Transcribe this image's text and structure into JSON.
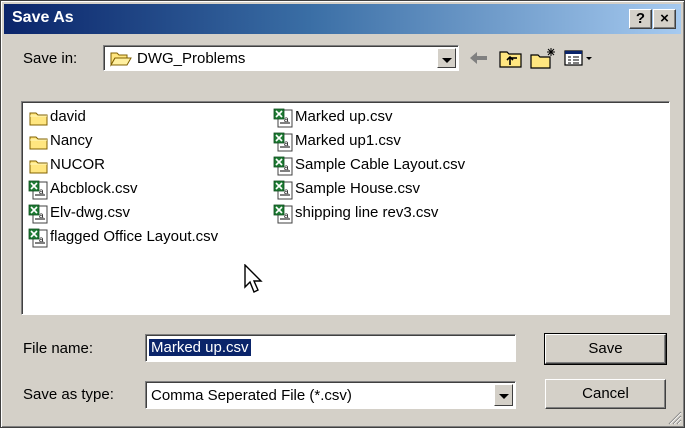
{
  "window": {
    "title": "Save As",
    "help_label": "?",
    "close_label": "×"
  },
  "save_in": {
    "label": "Save in:",
    "value": "DWG_Problems"
  },
  "toolbar": {
    "icons": [
      "back-arrow-icon",
      "up-one-level-icon",
      "new-folder-icon",
      "view-menu-icon"
    ]
  },
  "files": {
    "column1": [
      {
        "name": "david",
        "icon": "folder-icon"
      },
      {
        "name": "Nancy",
        "icon": "folder-icon"
      },
      {
        "name": "NUCOR",
        "icon": "folder-icon"
      },
      {
        "name": "Abcblock.csv",
        "icon": "excel-csv-icon"
      },
      {
        "name": "Elv-dwg.csv",
        "icon": "excel-csv-icon"
      },
      {
        "name": "flagged Office Layout.csv",
        "icon": "excel-csv-icon"
      }
    ],
    "column2": [
      {
        "name": "Marked up.csv",
        "icon": "excel-csv-icon"
      },
      {
        "name": "Marked up1.csv",
        "icon": "excel-csv-icon"
      },
      {
        "name": "Sample Cable Layout.csv",
        "icon": "excel-csv-icon"
      },
      {
        "name": "Sample House.csv",
        "icon": "excel-csv-icon"
      },
      {
        "name": "shipping line rev3.csv",
        "icon": "excel-csv-icon"
      }
    ]
  },
  "file_name": {
    "label": "File name:",
    "value": "Marked up.csv"
  },
  "save_as_type": {
    "label": "Save as type:",
    "value": "Comma Seperated File (*.csv)"
  },
  "buttons": {
    "save": "Save",
    "cancel": "Cancel"
  },
  "colors": {
    "title_start": "#0a246a",
    "title_end": "#a6caf0",
    "face": "#d4d0c8",
    "selection": "#0a246a",
    "folder": "#ffe680",
    "excel_green": "#1e7b34"
  }
}
